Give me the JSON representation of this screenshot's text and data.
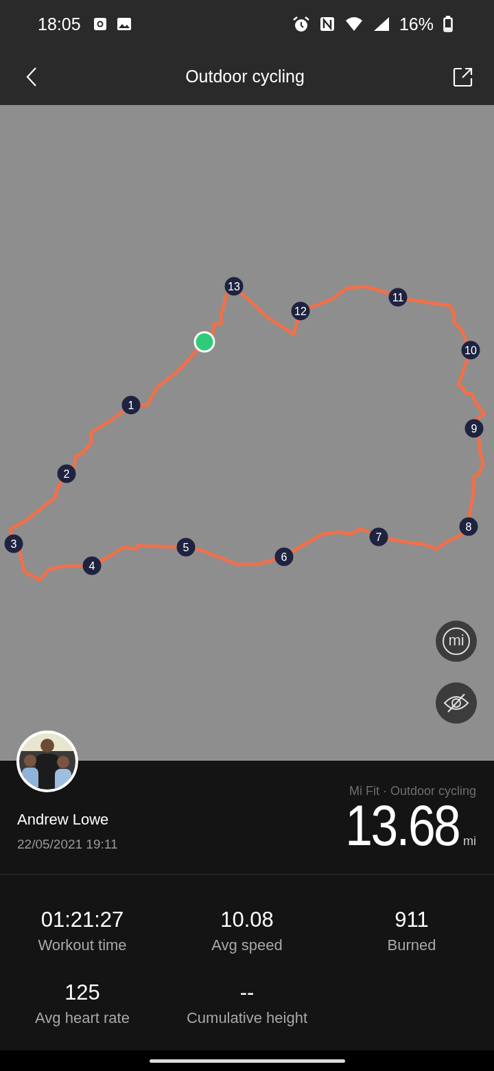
{
  "status_bar": {
    "time": "18:05",
    "battery": "16%"
  },
  "header": {
    "title": "Outdoor cycling"
  },
  "map": {
    "start_marker": true,
    "markers": [
      "1",
      "2",
      "3",
      "4",
      "5",
      "6",
      "7",
      "8",
      "9",
      "10",
      "11",
      "12",
      "13"
    ],
    "logo_button": "mi"
  },
  "summary": {
    "name": "Andrew Lowe",
    "date": "22/05/2021 19:11",
    "source": "Mi Fit · Outdoor cycling",
    "distance": "13.68",
    "unit": "mi"
  },
  "stats": [
    {
      "value": "01:21:27",
      "label": "Workout time"
    },
    {
      "value": "10.08",
      "label": "Avg speed"
    },
    {
      "value": "911",
      "label": "Burned"
    },
    {
      "value": "125",
      "label": "Avg heart rate"
    },
    {
      "value": "--",
      "label": "Cumulative height"
    }
  ]
}
